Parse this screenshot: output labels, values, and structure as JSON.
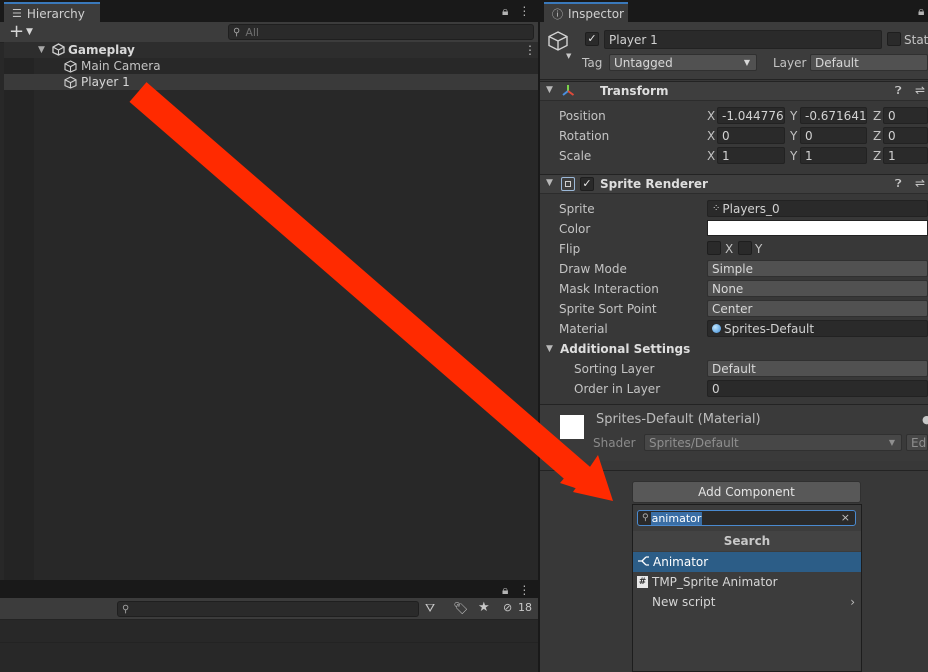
{
  "hierarchy": {
    "tab_label": "Hierarchy",
    "search_placeholder": "All",
    "scene_name": "Gameplay",
    "items": [
      {
        "label": "Main Camera"
      },
      {
        "label": "Player 1"
      }
    ]
  },
  "project": {
    "hidden_count": "18"
  },
  "inspector": {
    "tab_label": "Inspector",
    "object_name": "Player 1",
    "static_label": "Stat",
    "tag_label": "Tag",
    "tag_value": "Untagged",
    "layer_label": "Layer",
    "layer_value": "Default",
    "transform": {
      "title": "Transform",
      "rows": [
        {
          "label": "Position",
          "x": "-1.044776",
          "y": "-0.6716418",
          "z": "0"
        },
        {
          "label": "Rotation",
          "x": "0",
          "y": "0",
          "z": "0"
        },
        {
          "label": "Scale",
          "x": "1",
          "y": "1",
          "z": "1"
        }
      ],
      "axis_x": "X",
      "axis_y": "Y",
      "axis_z": "Z"
    },
    "sprite_renderer": {
      "title": "Sprite Renderer",
      "sprite_label": "Sprite",
      "sprite_value": "Players_0",
      "color_label": "Color",
      "color_value": "#ffffff",
      "flip_label": "Flip",
      "flip_x": "X",
      "flip_y": "Y",
      "draw_mode_label": "Draw Mode",
      "draw_mode_value": "Simple",
      "mask_label": "Mask Interaction",
      "mask_value": "None",
      "sort_point_label": "Sprite Sort Point",
      "sort_point_value": "Center",
      "material_label": "Material",
      "material_value": "Sprites-Default",
      "additional_label": "Additional Settings",
      "sorting_layer_label": "Sorting Layer",
      "sorting_layer_value": "Default",
      "order_label": "Order in Layer",
      "order_value": "0"
    },
    "material": {
      "title": "Sprites-Default (Material)",
      "shader_label": "Shader",
      "shader_value": "Sprites/Default",
      "edit_label": "Ed"
    },
    "add_component": {
      "button_label": "Add Component",
      "search_value": "animator",
      "section_title": "Search",
      "results": [
        {
          "label": "Animator",
          "icon": "animator-icon"
        },
        {
          "label": "TMP_Sprite Animator",
          "icon": "script-hash-icon"
        },
        {
          "label": "New script",
          "icon": "chevron-right-icon"
        }
      ]
    }
  },
  "colors": {
    "accent_blue": "#3a79bb",
    "selection": "#2c5d87",
    "annotation_arrow": "#ff2a00"
  }
}
